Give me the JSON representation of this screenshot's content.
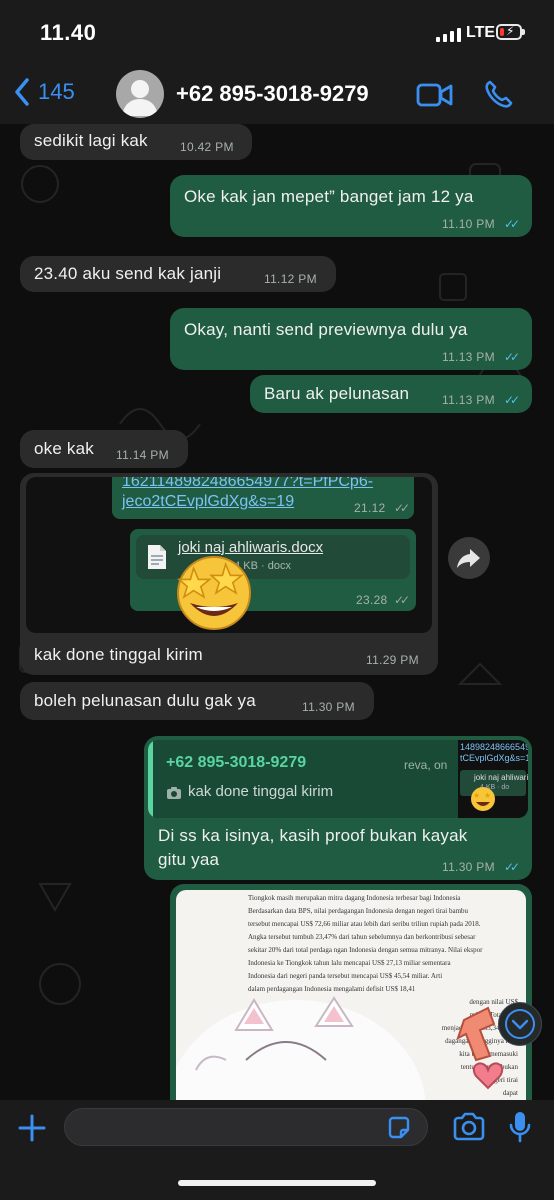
{
  "status_bar": {
    "time": "11.40",
    "network": "LTE",
    "battery_level": 0.2
  },
  "header": {
    "back_count": "145",
    "contact_name": "+62 895-3018-9279",
    "icons": [
      "chevron-left-icon",
      "avatar",
      "video-call-icon",
      "phone-icon"
    ]
  },
  "messages": [
    {
      "dir": "in",
      "text": "sedikit lagi kak",
      "time": "10.42 PM"
    },
    {
      "dir": "out",
      "text": "Oke kak jan mepet” banget jam 12 ya",
      "time": "11.10 PM",
      "status": "read"
    },
    {
      "dir": "in",
      "text": "23.40 aku send kak janji",
      "time": "11.12 PM"
    },
    {
      "dir": "out",
      "text": "Okay, nanti send previewnya dulu ya",
      "time": "11.13 PM",
      "status": "read"
    },
    {
      "dir": "out",
      "text": "Baru ak pelunasan",
      "time": "11.13 PM",
      "status": "read"
    },
    {
      "dir": "in",
      "text": "oke kak",
      "time": "11.14 PM"
    },
    {
      "dir": "in",
      "type": "image-with-caption",
      "screenshot": {
        "link_line1": "1621148982486654977?t=PfPCp6-",
        "link_line2": "jeco2tCEvplGdXg&s=19",
        "link_time": "21.12",
        "doc_name": "joki naj ahliwaris.docx",
        "doc_meta": "14 KB · docx",
        "doc_time": "23.28",
        "sticker": "star-struck"
      },
      "text": "kak done tinggal kirim",
      "time": "11.29 PM"
    },
    {
      "dir": "in",
      "text": "boleh pelunasan dulu gak ya",
      "time": "11.30 PM"
    },
    {
      "dir": "out",
      "type": "reply",
      "quote_author": "+62 895-3018-9279",
      "quote_text": "kak done tinggal kirim",
      "quote_snippet_left": "reva, on",
      "quote_thumb_line1": "14898248666549",
      "quote_thumb_line2": "tCEvplGdXg&s=19",
      "quote_thumb_doc": "joki naj ahliwaris",
      "quote_thumb_meta": "4 KB · do",
      "text_line1": "Di ss ka isinya, kasih proof bukan kayak",
      "text_line2": "gitu yaa",
      "time": "11.30 PM",
      "status": "read"
    },
    {
      "dir": "out",
      "type": "image",
      "doc_lines": [
        "Tiongkok masih merupakan mitra dagang Indonesia terbesar bagi Indonesia",
        "Berdasarkan data BPS, nilai perdagangan Indonesia dengan negeri tirai bambu",
        "tersebut mencapai US$ 72,66 miliar atau lebih dari seribu triliun rupiah pada 2018.",
        "Angka tersebut tumbuh 23,47% dari tahun sebelumnya dan berkontribusi sebesar",
        "sekitar 20% dari total perdaga ngan Indonesia dengan semua mitranya. Nilai ekspor",
        "Indonesia ke Tiongkok tahun lalu mencapai US$ 27,13 miliar sementara",
        "Indonesia dari negeri panda tersebut mencapai US$ 45,54 miliar. Arti",
        "dalam perdagangan Indonesia mengalami defisit US$ 18,41",
        "dengan nilai US$",
        "miliar. Total nilai",
        "menjadi US$ 263,34 miliar",
        "dagangan. Tingginya nilai",
        "kita untuk memasuki",
        "tentu memicu bukan",
        "negeri tirai",
        "dapat"
      ]
    }
  ],
  "input": {
    "placeholder": "",
    "value": ""
  }
}
